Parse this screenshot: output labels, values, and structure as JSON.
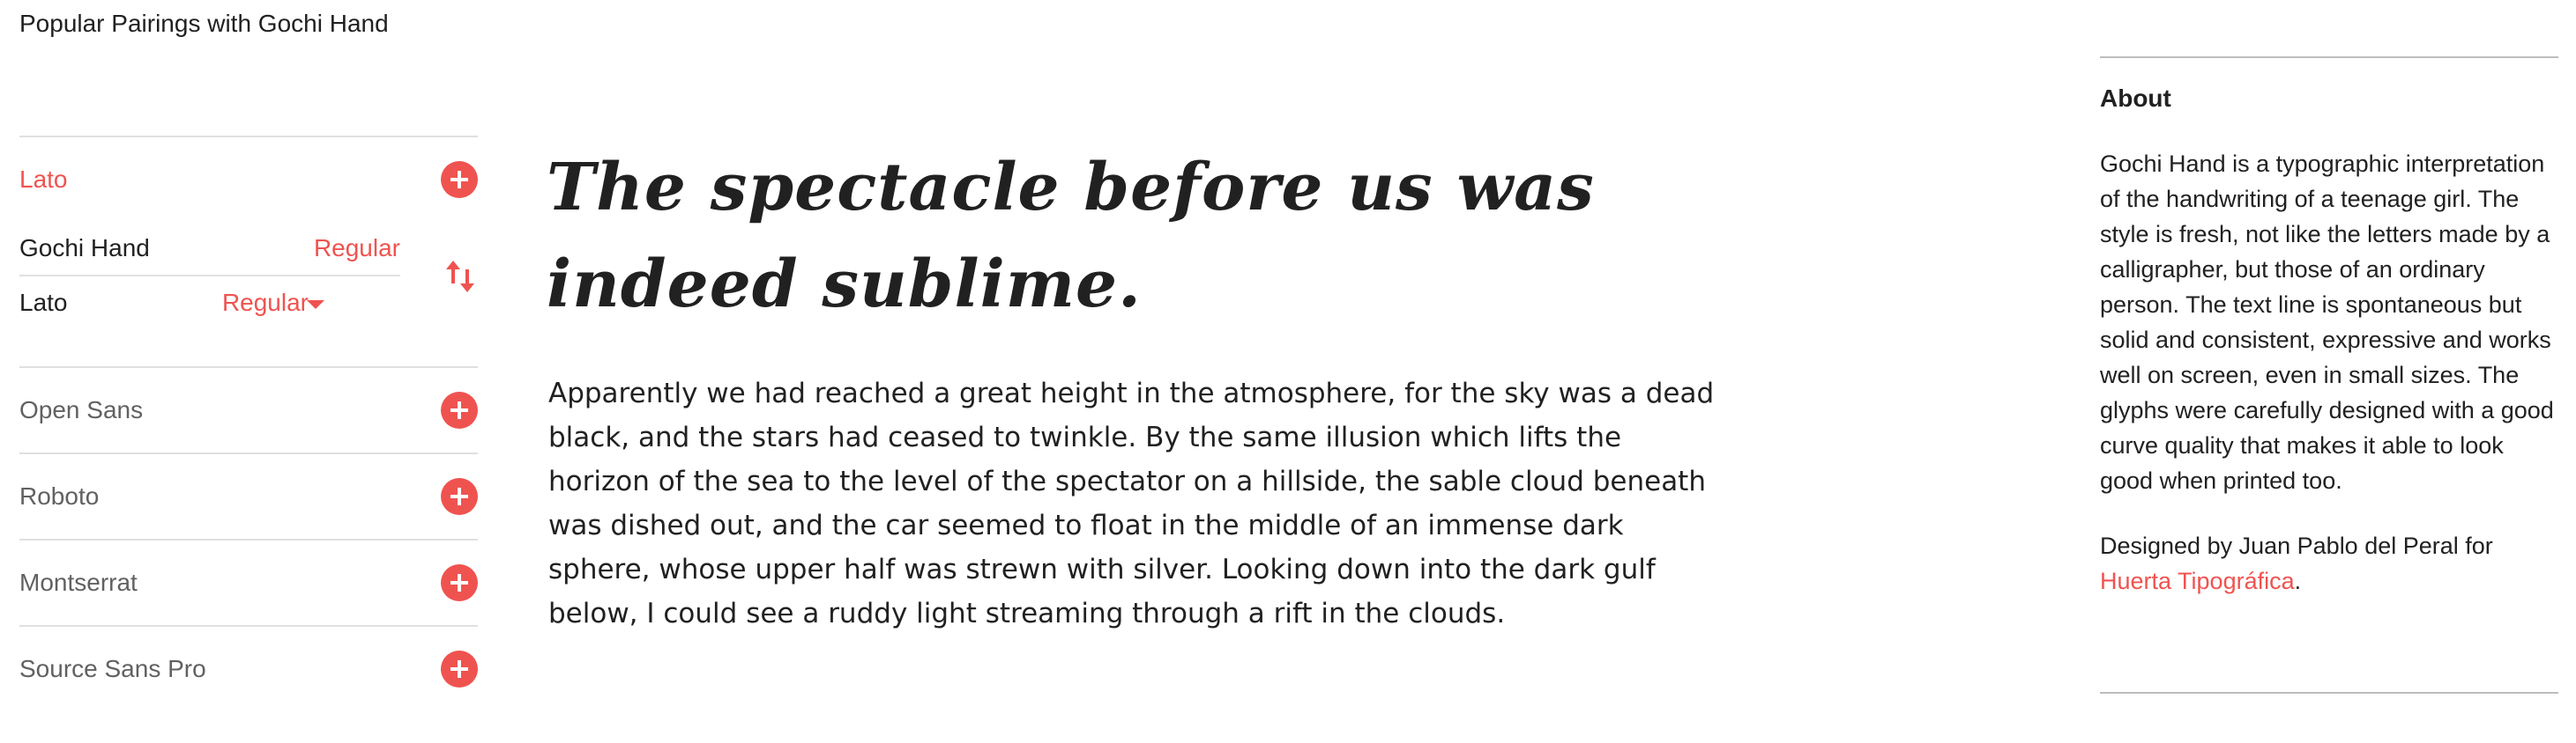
{
  "section_title": "Popular Pairings with Gochi Hand",
  "sidebar": {
    "active_item": {
      "label": "Lato"
    },
    "pairing": {
      "first": {
        "font": "Gochi Hand",
        "weight": "Regular"
      },
      "second": {
        "font": "Lato",
        "weight": "Regular"
      }
    },
    "items": [
      {
        "label": "Open Sans"
      },
      {
        "label": "Roboto"
      },
      {
        "label": "Montserrat"
      },
      {
        "label": "Source Sans Pro"
      }
    ]
  },
  "preview": {
    "heading": "The spectacle before us was indeed sublime.",
    "body": "Apparently we had reached a great height in the atmosphere, for the sky was a dead black, and the stars had ceased to twinkle. By the same illusion which lifts the horizon of the sea to the level of the spectator on a hillside, the sable cloud beneath was dished out, and the car seemed to float in the middle of an immense dark sphere, whose upper half was strewn with silver. Looking down into the dark gulf below, I could see a ruddy light streaming through a rift in the clouds."
  },
  "about": {
    "title": "About",
    "text": "Gochi Hand is a typographic interpretation of the handwriting of a teenage girl. The style is fresh, not like the letters made by a calligrapher, but those of an ordinary person. The text line is spontaneous but solid and consistent, expressive and works well on screen, even in small sizes. The glyphs were carefully designed with a good curve quality that makes it able to look good when printed too.",
    "designer_prefix": "Designed by Juan Pablo del Peral for",
    "designer_link": "Huerta Tipográfica",
    "designer_suffix": "."
  },
  "colors": {
    "accent": "#ef5350",
    "text": "#212121",
    "muted": "#616161",
    "divider": "#e0e0e0"
  },
  "icons": {
    "add": "add-circle-icon",
    "swap": "swap-vertical-icon",
    "dropdown": "caret-down-icon"
  }
}
